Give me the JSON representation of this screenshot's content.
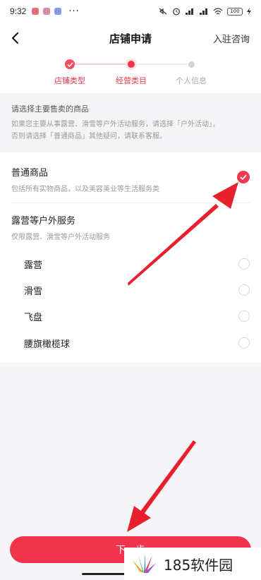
{
  "status_bar": {
    "time": "9:32",
    "menu": "···",
    "battery": "100"
  },
  "header": {
    "title": "店铺申请",
    "consult_link": "入驻咨询"
  },
  "steps": [
    {
      "label": "店铺类型",
      "state": "done"
    },
    {
      "label": "经营类目",
      "state": "current"
    },
    {
      "label": "个人信息",
      "state": "todo"
    }
  ],
  "notice": {
    "title": "请选择主要售卖的商品",
    "line1": "如果您主要从事露营、滑雪等户外活动服务，请选择「户外活动」，",
    "line2": "否则请选择「普通商品」其他疑问，请联系客服。"
  },
  "options": [
    {
      "title": "普通商品",
      "subtitle": "包括所有实物商品，以及美容美业等生活服务类",
      "selected": true
    },
    {
      "title": "露营等户外服务",
      "subtitle": "仅限露营、滑雪等户外活动服务",
      "selected": false
    }
  ],
  "sub_items": [
    {
      "label": "露营",
      "selected": false
    },
    {
      "label": "滑雪",
      "selected": false
    },
    {
      "label": "飞盘",
      "selected": false
    },
    {
      "label": "腰旗橄榄球",
      "selected": false
    }
  ],
  "submit_label": "下一步",
  "watermark": {
    "text": "185软件园"
  },
  "colors": {
    "accent": "#f0344c",
    "arrow": "#e8202e",
    "background": "#f5f5f7"
  },
  "icons": {
    "back": "chevron-left-icon",
    "check": "check-circle-icon"
  }
}
